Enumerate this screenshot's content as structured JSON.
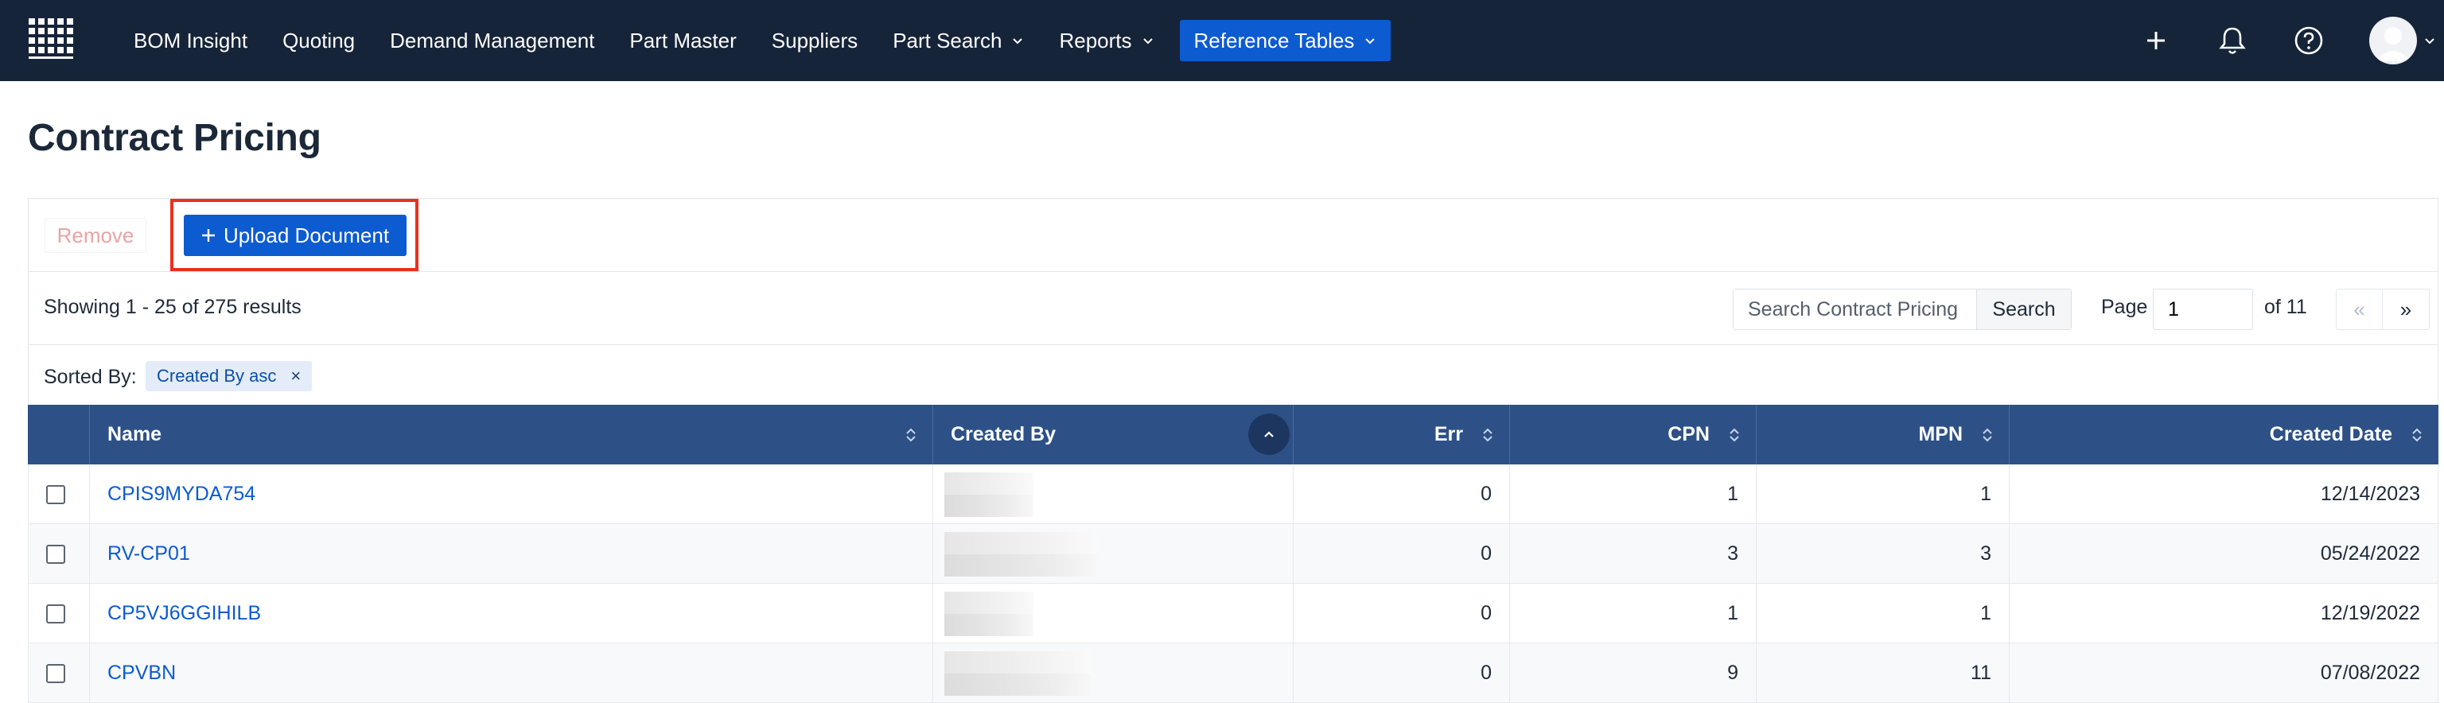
{
  "nav": {
    "items": [
      {
        "label": "BOM Insight",
        "dropdown": false
      },
      {
        "label": "Quoting",
        "dropdown": false
      },
      {
        "label": "Demand Management",
        "dropdown": false
      },
      {
        "label": "Part Master",
        "dropdown": false
      },
      {
        "label": "Suppliers",
        "dropdown": false
      },
      {
        "label": "Part Search",
        "dropdown": true
      },
      {
        "label": "Reports",
        "dropdown": true
      },
      {
        "label": "Reference Tables",
        "dropdown": true,
        "active": true
      }
    ]
  },
  "page": {
    "title": "Contract Pricing"
  },
  "toolbar": {
    "remove_label": "Remove",
    "upload_label": "Upload Document"
  },
  "results": {
    "summary": "Showing 1 - 25 of 275 results",
    "search_placeholder": "Search Contract Pricing",
    "search_label": "Search",
    "page_label": "Page",
    "page_value": "1",
    "of_label": "of 11",
    "prev_label": "«",
    "next_label": "»"
  },
  "sorting": {
    "label": "Sorted By:",
    "chip": "Created By asc",
    "chip_close": "×"
  },
  "table": {
    "columns": [
      "Name",
      "Created By",
      "Err",
      "CPN",
      "MPN",
      "Created Date"
    ],
    "rows": [
      {
        "name": "CPIS9MYDA754",
        "err": "0",
        "cpn": "1",
        "mpn": "1",
        "date": "12/14/2023"
      },
      {
        "name": "RV-CP01",
        "err": "0",
        "cpn": "3",
        "mpn": "3",
        "date": "05/24/2022"
      },
      {
        "name": "CP5VJ6GGIHILB",
        "err": "0",
        "cpn": "1",
        "mpn": "1",
        "date": "12/19/2022"
      },
      {
        "name": "CPVBN",
        "err": "0",
        "cpn": "9",
        "mpn": "11",
        "date": "07/08/2022"
      }
    ]
  },
  "colors": {
    "nav_bg": "#16243a",
    "accent": "#0c5bd1",
    "table_header": "#2d5186",
    "highlight": "#e8321d"
  }
}
